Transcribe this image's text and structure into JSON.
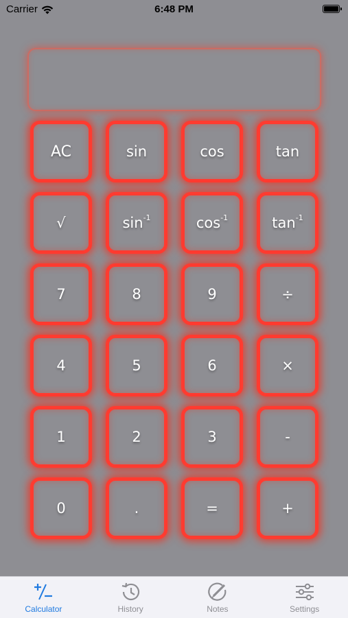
{
  "status_bar": {
    "carrier": "Carrier",
    "time": "6:48 PM"
  },
  "display": {
    "value": ""
  },
  "keys": [
    {
      "label": "AC",
      "sup": ""
    },
    {
      "label": "sin",
      "sup": ""
    },
    {
      "label": "cos",
      "sup": ""
    },
    {
      "label": "tan",
      "sup": ""
    },
    {
      "label": "√",
      "sup": ""
    },
    {
      "label": "sin",
      "sup": "-1"
    },
    {
      "label": "cos",
      "sup": "-1"
    },
    {
      "label": "tan",
      "sup": "-1"
    },
    {
      "label": "7",
      "sup": ""
    },
    {
      "label": "8",
      "sup": ""
    },
    {
      "label": "9",
      "sup": ""
    },
    {
      "label": "÷",
      "sup": ""
    },
    {
      "label": "4",
      "sup": ""
    },
    {
      "label": "5",
      "sup": ""
    },
    {
      "label": "6",
      "sup": ""
    },
    {
      "label": "×",
      "sup": ""
    },
    {
      "label": "1",
      "sup": ""
    },
    {
      "label": "2",
      "sup": ""
    },
    {
      "label": "3",
      "sup": ""
    },
    {
      "label": "-",
      "sup": ""
    },
    {
      "label": "0",
      "sup": ""
    },
    {
      "label": ".",
      "sup": ""
    },
    {
      "label": "=",
      "sup": ""
    },
    {
      "label": "+",
      "sup": ""
    }
  ],
  "tabs": [
    {
      "label": "Calculator",
      "icon": "plus-minus-icon",
      "active": true
    },
    {
      "label": "History",
      "icon": "history-clock-icon",
      "active": false
    },
    {
      "label": "Notes",
      "icon": "pen-circle-icon",
      "active": false
    },
    {
      "label": "Settings",
      "icon": "sliders-icon",
      "active": false
    }
  ],
  "colors": {
    "background": "#8e8e93",
    "key_border": "#ff3b30",
    "active_tab": "#1f7ae0",
    "inactive_tab": "#8e8e93"
  }
}
